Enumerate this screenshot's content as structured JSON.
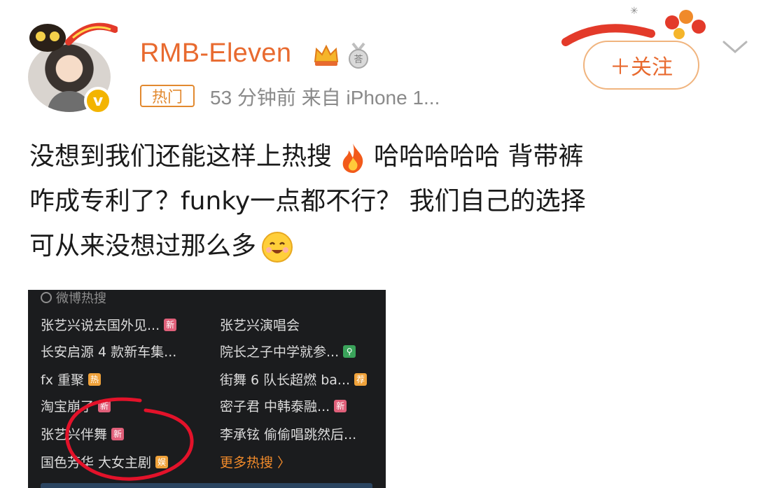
{
  "header": {
    "username": "RMB-Eleven",
    "hot_tag": "热门",
    "meta": "53 分钟前   来自 iPhone 1...",
    "follow_label": "＋关注",
    "verify_mark": "v"
  },
  "post": {
    "line1_a": "没想到我们还能这样上热搜",
    "line1_b": "哈哈哈哈哈 背带裤",
    "line2": "咋成专利了？funky一点都不行？ 我们自己的选择",
    "line3": "可从来没想过那么多"
  },
  "screenshot": {
    "title": "微博热搜",
    "items": [
      {
        "text": "张艺兴说去国外见...",
        "badge": "新",
        "badge_color": "#e0607a"
      },
      {
        "text": "张艺兴演唱会",
        "badge": "",
        "badge_color": ""
      },
      {
        "text": "长安启源 4 款新车集...",
        "badge": "",
        "badge_color": ""
      },
      {
        "text": "院长之子中学就参...",
        "badge": "⚲",
        "badge_color": "#3aa35a"
      },
      {
        "text": "fx 重聚",
        "badge": "热",
        "badge_color": "#f0a23a"
      },
      {
        "text": "街舞 6 队长超燃 ba...",
        "badge": "荐",
        "badge_color": "#f0a23a"
      },
      {
        "text": "淘宝崩了",
        "badge": "新",
        "badge_color": "#e0607a"
      },
      {
        "text": "密子君 中韩泰融...",
        "badge": "新",
        "badge_color": "#e0607a"
      },
      {
        "text": "张艺兴伴舞",
        "badge": "新",
        "badge_color": "#e0607a"
      },
      {
        "text": "李承铉 偷偷唱跳然后...",
        "badge": "",
        "badge_color": ""
      },
      {
        "text": "国色芳华 大女主剧",
        "badge": "娱",
        "badge_color": "#f0a23a"
      },
      {
        "text": "更多热搜 〉",
        "badge": "",
        "badge_color": ""
      }
    ]
  },
  "icons": [
    "crown-icon",
    "medal-icon",
    "verify-icon",
    "chevron-down-icon",
    "fire-emoji",
    "smile-emoji",
    "search-icon"
  ],
  "colors": {
    "accent": "#e86a2f",
    "hot_tag": "#e2892f",
    "more": "#f08a2a",
    "circle": "#e3122a"
  }
}
